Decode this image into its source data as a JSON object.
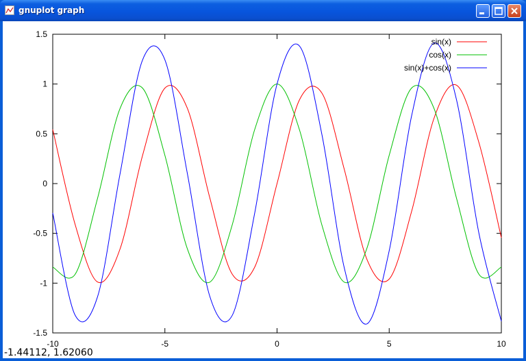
{
  "window": {
    "title": "gnuplot graph",
    "title_color": "#ffffff"
  },
  "status": {
    "coordinates": "-1.44112, 1.62060"
  },
  "chart_data": {
    "type": "line",
    "xlim": [
      -10,
      10
    ],
    "ylim": [
      -1.5,
      1.5
    ],
    "x_ticks": [
      {
        "value": -10,
        "label": "-10"
      },
      {
        "value": -5,
        "label": "-5"
      },
      {
        "value": 0,
        "label": "0"
      },
      {
        "value": 5,
        "label": "5"
      },
      {
        "value": 10,
        "label": "10"
      }
    ],
    "y_ticks": [
      {
        "value": 1.5,
        "label": "1.5"
      },
      {
        "value": 1,
        "label": "1"
      },
      {
        "value": 0.5,
        "label": "0.5"
      },
      {
        "value": 0,
        "label": "0"
      },
      {
        "value": -0.5,
        "label": "-0.5"
      },
      {
        "value": -1,
        "label": "-1"
      },
      {
        "value": -1.5,
        "label": "-1.5"
      }
    ],
    "grid": false,
    "legend_position": "top-right",
    "x": [
      -10,
      -9,
      -8,
      -7,
      -6,
      -5,
      -4,
      -3,
      -2,
      -1,
      0,
      1,
      2,
      3,
      4,
      5,
      6,
      7,
      8,
      9,
      10
    ],
    "series": [
      {
        "name": "sin(x)",
        "color": "#ff0000",
        "values": [
          0.544,
          -0.412,
          -0.989,
          -0.657,
          0.279,
          0.959,
          0.757,
          -0.141,
          -0.909,
          -0.841,
          0,
          0.841,
          0.909,
          0.141,
          -0.757,
          -0.959,
          -0.279,
          0.657,
          0.989,
          0.412,
          -0.544
        ]
      },
      {
        "name": "cos(x)",
        "color": "#00c000",
        "values": [
          -0.839,
          -0.911,
          -0.146,
          0.754,
          0.96,
          0.284,
          -0.654,
          -0.99,
          -0.416,
          0.54,
          1,
          0.54,
          -0.416,
          -0.99,
          -0.654,
          0.284,
          0.96,
          0.754,
          -0.146,
          -0.911,
          -0.839
        ]
      },
      {
        "name": "sin(x)+cos(x)",
        "color": "#0000ff",
        "values": [
          -0.295,
          -1.323,
          -1.135,
          0.097,
          1.239,
          1.243,
          0.103,
          -1.131,
          -1.325,
          -0.301,
          1,
          1.382,
          0.493,
          -0.849,
          -1.41,
          -0.675,
          0.681,
          1.411,
          0.843,
          -0.499,
          -1.383
        ]
      }
    ]
  }
}
